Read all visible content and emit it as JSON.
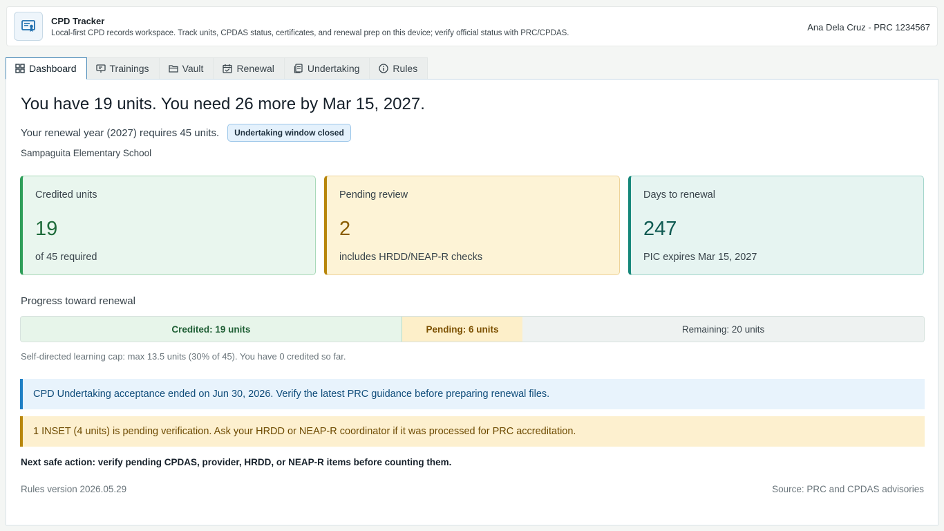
{
  "app": {
    "title": "CPD Tracker",
    "subtitle": "Local-first CPD records workspace. Track units, CPDAS status, certificates, and renewal prep on this device; verify official status with PRC/CPDAS.",
    "user": "Ana Dela Cruz - PRC 1234567",
    "logo_icon": "certificate-icon"
  },
  "tabs": [
    {
      "label": "Dashboard",
      "icon": "grid-icon",
      "active": true
    },
    {
      "label": "Trainings",
      "icon": "presentation-icon",
      "active": false
    },
    {
      "label": "Vault",
      "icon": "folder-icon",
      "active": false
    },
    {
      "label": "Renewal",
      "icon": "calendar-icon",
      "active": false
    },
    {
      "label": "Undertaking",
      "icon": "document-icon",
      "active": false
    },
    {
      "label": "Rules",
      "icon": "info-icon",
      "active": false
    }
  ],
  "dashboard": {
    "headline": "You have 19 units. You need 26 more by Mar 15, 2027.",
    "subline": "Your renewal year (2027) requires 45 units.",
    "badge": "Undertaking window closed",
    "school": "Sampaguita Elementary School",
    "cards": [
      {
        "label": "Credited units",
        "value": "19",
        "foot": "of 45 required"
      },
      {
        "label": "Pending review",
        "value": "2",
        "foot": "includes HRDD/NEAP-R checks"
      },
      {
        "label": "Days to renewal",
        "value": "247",
        "foot": "PIC expires Mar 15, 2027"
      }
    ],
    "progress": {
      "title": "Progress toward renewal",
      "required": 45,
      "credited_units": 19,
      "pending_units": 6,
      "remaining_units": 20,
      "credited_label": "Credited: 19 units",
      "pending_label": "Pending: 6 units",
      "remaining_label": "Remaining: 20 units"
    },
    "cap_note": "Self-directed learning cap: max 13.5 units (30% of 45). You have 0 credited so far.",
    "alerts": {
      "info": "CPD Undertaking acceptance ended on Jun 30, 2026. Verify the latest PRC guidance before preparing renewal files.",
      "warn": "1 INSET (4 units) is pending verification. Ask your HRDD or NEAP-R coordinator if it was processed for PRC accreditation."
    },
    "next_action": "Next safe action: verify pending CPDAS, provider, HRDD, or NEAP-R items before counting them.",
    "rules_version": "Rules version 2026.05.29",
    "source": "Source: PRC and CPDAS advisories"
  },
  "colors": {
    "accent": "#1f7fc4",
    "credited": "#2f9e59",
    "pending": "#b8860b",
    "teal": "#16877a"
  }
}
